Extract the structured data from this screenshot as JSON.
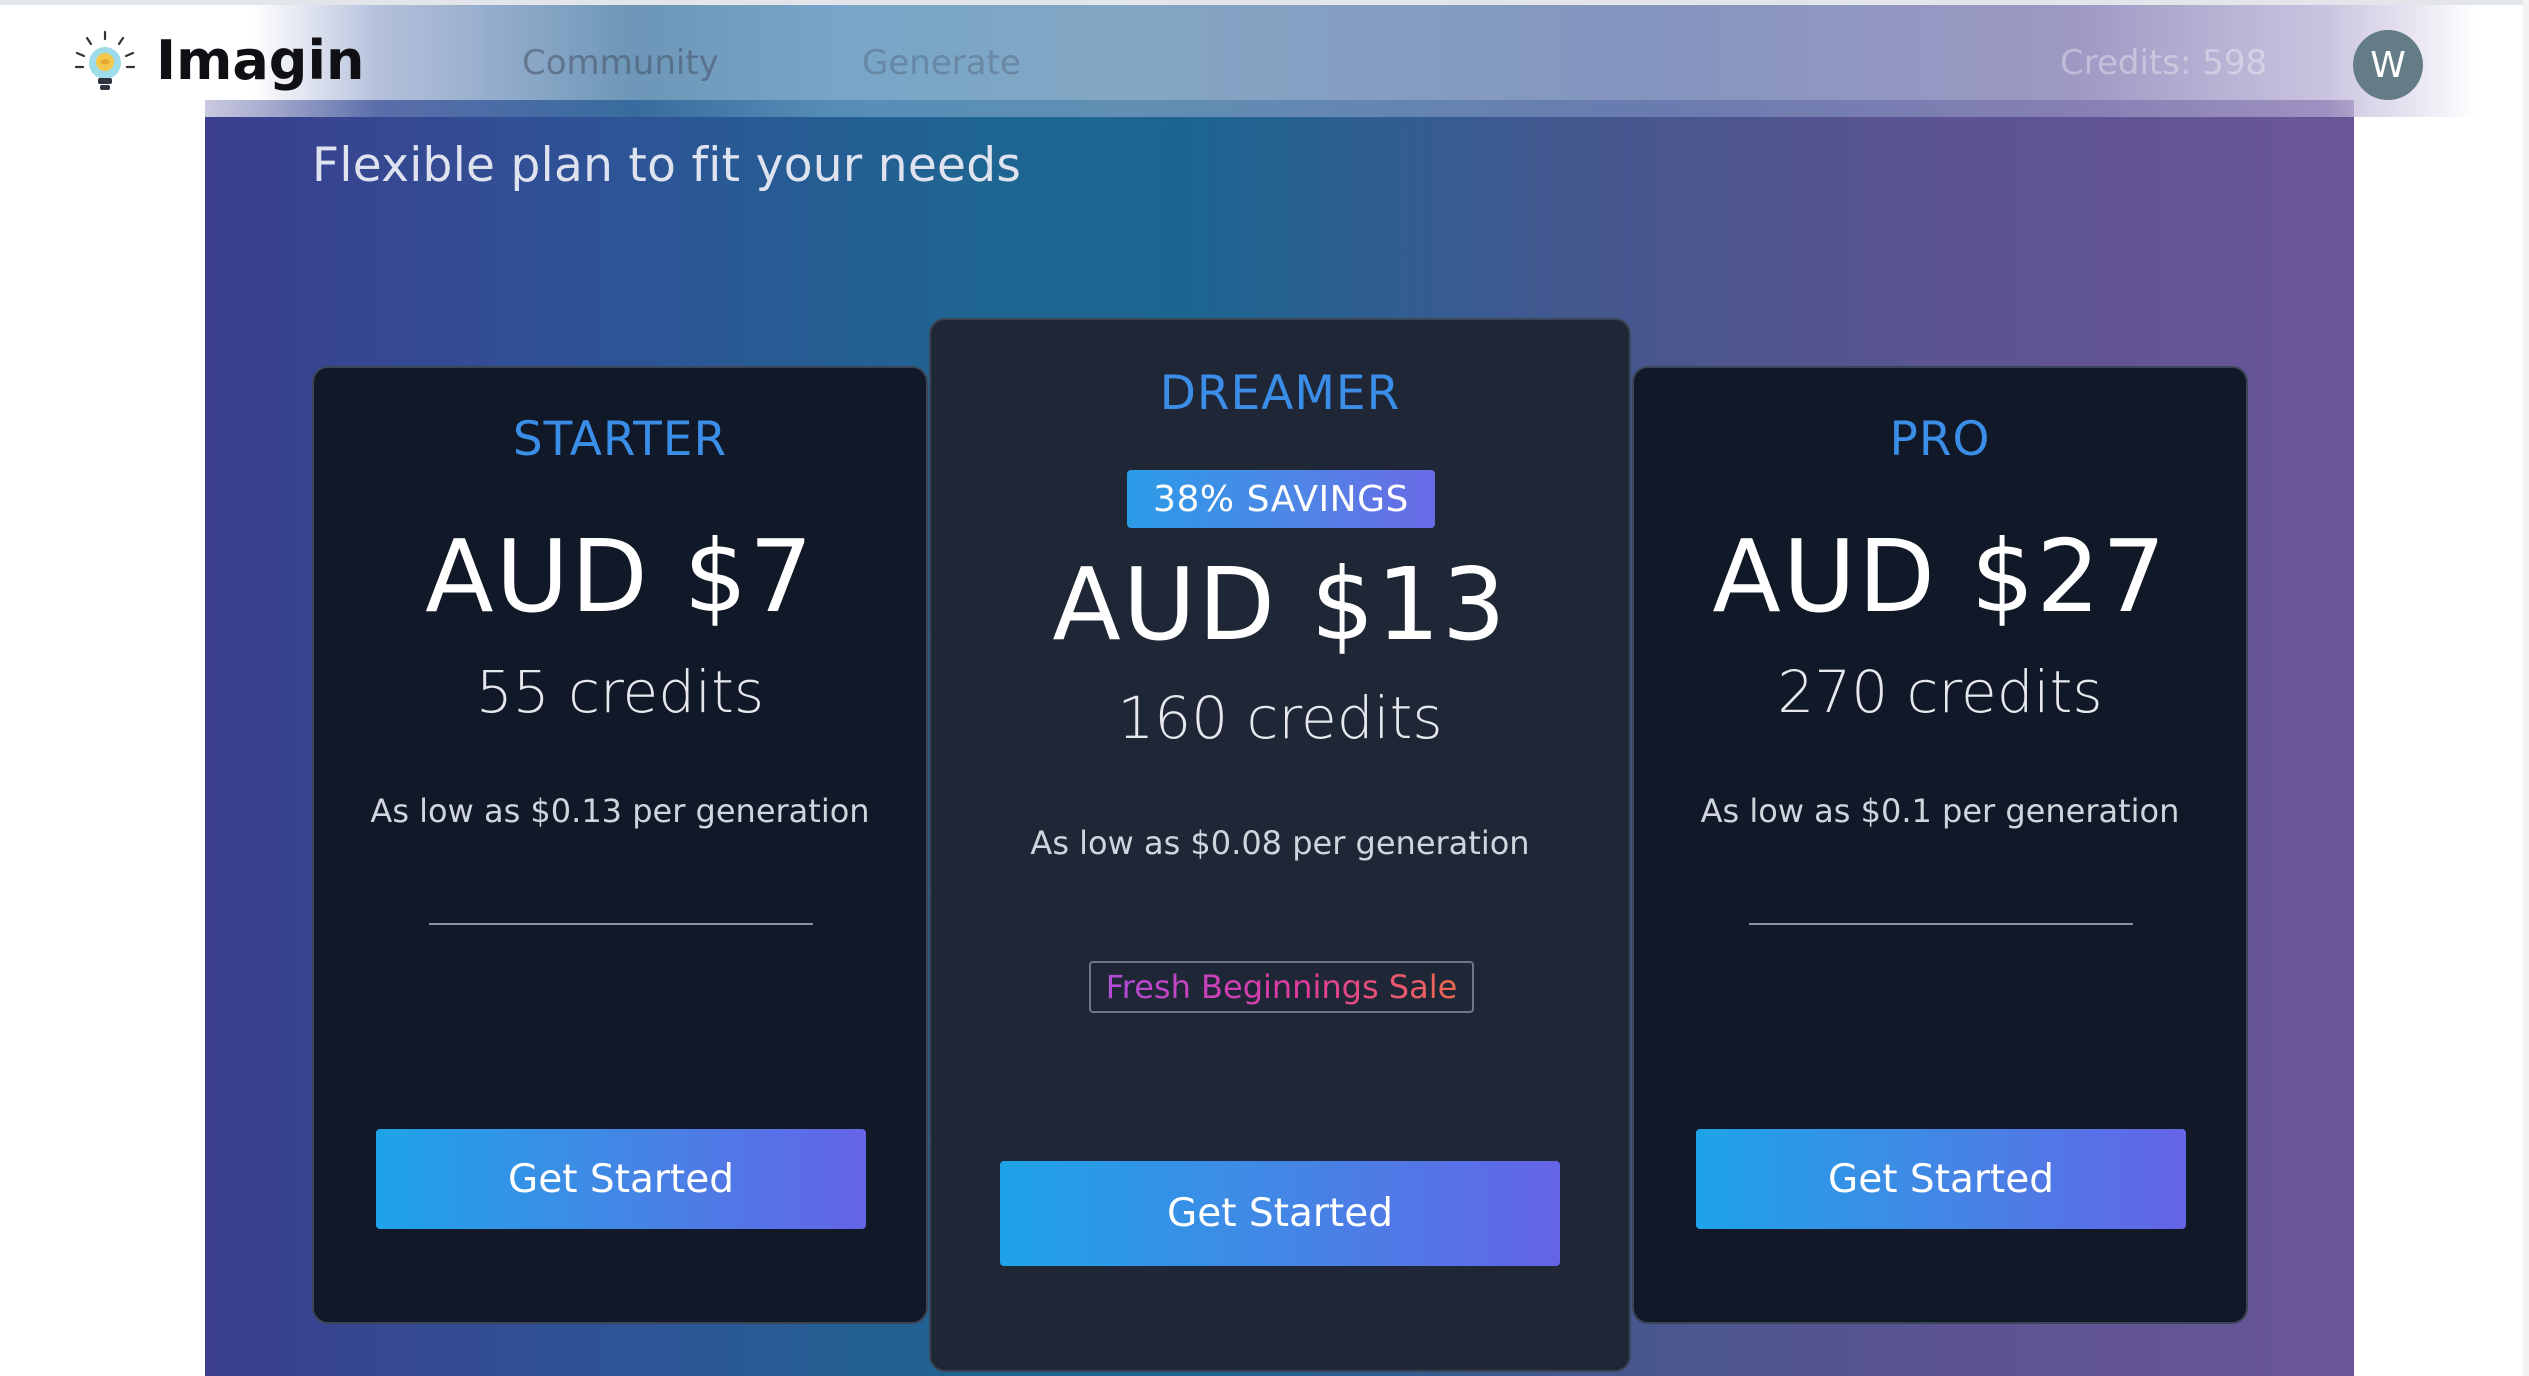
{
  "app": {
    "name": "Imagin",
    "brand_color": "#0f0f14"
  },
  "nav": {
    "links": [
      {
        "label": "Community"
      },
      {
        "label": "Generate"
      }
    ],
    "credits_text": "Credits: 598",
    "avatar_initial": "W"
  },
  "page": {
    "headline": "Flexible plan to fit your needs"
  },
  "plans": [
    {
      "name": "STARTER",
      "price": "AUD $7",
      "credits": "55 credits",
      "per_generation": "As low as $0.13 per generation",
      "cta": "Get Started"
    },
    {
      "name": "DREAMER",
      "badge": "38% SAVINGS",
      "price": "AUD $13",
      "credits": "160 credits",
      "per_generation": "As low as $0.08 per generation",
      "promo": "Fresh Beginnings Sale",
      "cta": "Get Started",
      "featured": true
    },
    {
      "name": "PRO",
      "price": "AUD $27",
      "credits": "270 credits",
      "per_generation": "As low as $0.1 per generation",
      "cta": "Get Started"
    }
  ],
  "colors": {
    "accent": "#3b8ee8",
    "card_bg": "#111827",
    "featured_card_bg": "#1f2737",
    "button_gradient_start": "#1ea3e8",
    "button_gradient_end": "#6464e6"
  },
  "icons": {
    "logo": "lightbulb-brain-icon"
  }
}
